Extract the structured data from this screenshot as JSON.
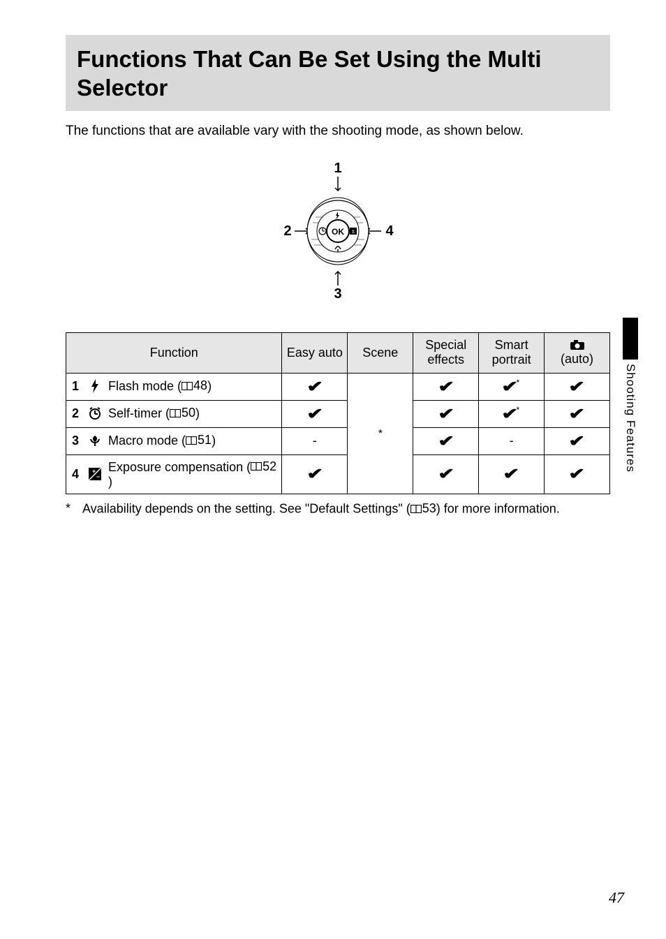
{
  "title": "Functions That Can Be Set Using the Multi Selector",
  "intro": "The functions that are available vary with the shooting mode, as shown below.",
  "diagram": {
    "labels": [
      "1",
      "2",
      "3",
      "4"
    ],
    "center": "OK"
  },
  "table": {
    "headers": {
      "function": "Function",
      "easy_auto": "Easy auto",
      "scene": "Scene",
      "special": "Special effects",
      "smart": "Smart portrait",
      "auto": "(auto)"
    },
    "scene_cell": "*",
    "rows": [
      {
        "num": "1",
        "icon": "flash-icon",
        "label": "Flash mode (",
        "ref": "48",
        "label_end": ")",
        "easy_auto": "check",
        "special": "check",
        "smart": "check-star",
        "auto": "check"
      },
      {
        "num": "2",
        "icon": "timer-icon",
        "label": "Self-timer (",
        "ref": "50",
        "label_end": ")",
        "easy_auto": "check",
        "special": "check",
        "smart": "check-star",
        "auto": "check"
      },
      {
        "num": "3",
        "icon": "macro-icon",
        "label": "Macro mode (",
        "ref": "51",
        "label_end": ")",
        "easy_auto": "-",
        "special": "check",
        "smart": "-",
        "auto": "check"
      },
      {
        "num": "4",
        "icon": "exposure-icon",
        "label": "Exposure compensation (",
        "ref": "52",
        "label_end": ")",
        "easy_auto": "check",
        "special": "check",
        "smart": "check",
        "auto": "check"
      }
    ]
  },
  "footnote": {
    "marker": "*",
    "text_a": "Availability depends on the setting. See \"Default Settings\" (",
    "ref": "53",
    "text_b": ") for more information."
  },
  "side_label": "Shooting Features",
  "page_number": "47"
}
